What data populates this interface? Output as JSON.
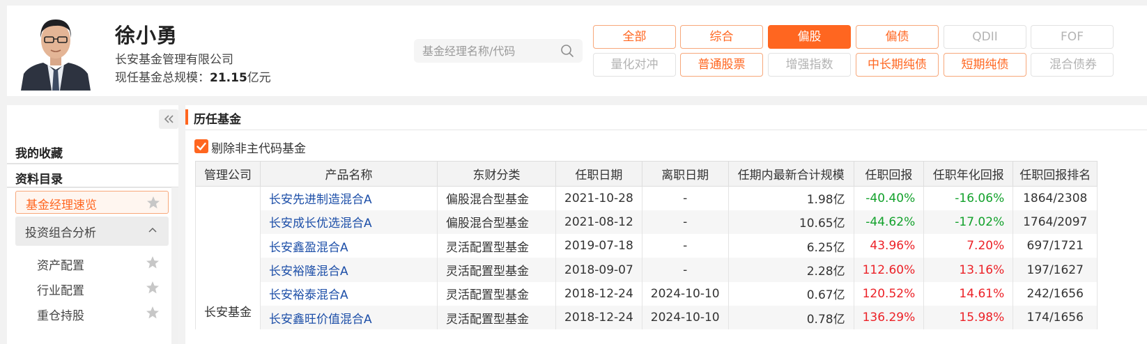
{
  "colors": {
    "accent": "#ff6620",
    "positive": "#ec2127",
    "negative": "#12a12b",
    "link": "#1d4fa8"
  },
  "manager": {
    "name": "徐小勇",
    "company": "长安基金管理有限公司",
    "scale_label": "现任基金总规模：",
    "scale_value": "21.15",
    "scale_unit": "亿元"
  },
  "search": {
    "placeholder": "基金经理名称/代码",
    "value": ""
  },
  "filters": {
    "row1": [
      {
        "label": "全部",
        "state": "normal"
      },
      {
        "label": "综合",
        "state": "normal"
      },
      {
        "label": "偏股",
        "state": "active"
      },
      {
        "label": "偏债",
        "state": "normal"
      },
      {
        "label": "QDII",
        "state": "disabled"
      },
      {
        "label": "FOF",
        "state": "disabled"
      }
    ],
    "row2": [
      {
        "label": "量化对冲",
        "state": "disabled"
      },
      {
        "label": "普通股票",
        "state": "normal"
      },
      {
        "label": "增强指数",
        "state": "disabled"
      },
      {
        "label": "中长期纯债",
        "state": "normal"
      },
      {
        "label": "短期纯债",
        "state": "normal"
      },
      {
        "label": "混合债券",
        "state": "disabled"
      }
    ]
  },
  "sidebar": {
    "favorites": "我的收藏",
    "catalog": "资料目录",
    "active_item": "基金经理速览",
    "group": "投资组合分析",
    "sub_items": [
      "资产配置",
      "行业配置",
      "重仓持股"
    ]
  },
  "main": {
    "section_title": "历任基金",
    "checkbox_label": "剔除非主代码基金",
    "checkbox_checked": true,
    "table": {
      "headers": [
        "管理公司",
        "产品名称",
        "东财分类",
        "任职日期",
        "离职日期",
        "任期内最新合计规模",
        "任职回报",
        "任职年化回报",
        "任职回报排名"
      ],
      "company": "长安基金",
      "rows": [
        {
          "name": "长安先进制造混合A",
          "category": "偏股混合型基金",
          "start": "2021-10-28",
          "end": "-",
          "scale": "1.98亿",
          "return": "-40.40%",
          "annual": "-16.06%",
          "rank": "1864/2308"
        },
        {
          "name": "长安成长优选混合A",
          "category": "偏股混合型基金",
          "start": "2021-08-12",
          "end": "-",
          "scale": "10.65亿",
          "return": "-44.62%",
          "annual": "-17.02%",
          "rank": "1764/2097"
        },
        {
          "name": "长安鑫盈混合A",
          "category": "灵活配置型基金",
          "start": "2019-07-18",
          "end": "-",
          "scale": "6.25亿",
          "return": "43.96%",
          "annual": "7.20%",
          "rank": "697/1721"
        },
        {
          "name": "长安裕隆混合A",
          "category": "灵活配置型基金",
          "start": "2018-09-07",
          "end": "-",
          "scale": "2.28亿",
          "return": "112.60%",
          "annual": "13.16%",
          "rank": "197/1627"
        },
        {
          "name": "长安裕泰混合A",
          "category": "灵活配置型基金",
          "start": "2018-12-24",
          "end": "2024-10-10",
          "scale": "0.67亿",
          "return": "120.52%",
          "annual": "14.61%",
          "rank": "242/1656"
        },
        {
          "name": "长安鑫旺价值混合A",
          "category": "灵活配置型基金",
          "start": "2018-12-24",
          "end": "2024-10-10",
          "scale": "0.78亿",
          "return": "136.29%",
          "annual": "15.98%",
          "rank": "174/1656"
        }
      ]
    }
  }
}
